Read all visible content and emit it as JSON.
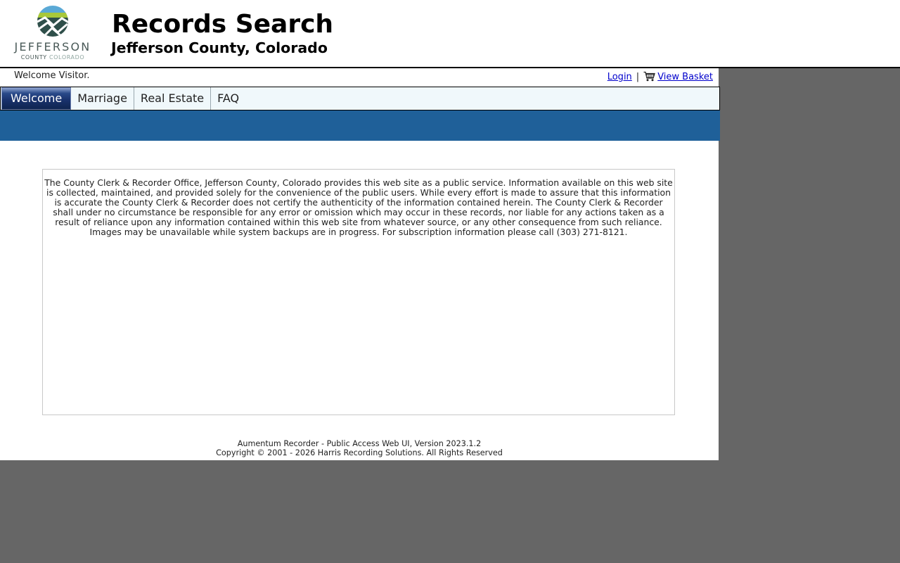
{
  "header": {
    "logo": {
      "word": "JEFFERSON",
      "sub_county": "COUNTY",
      "sub_state": "COLORADO"
    },
    "title": "Records Search",
    "subtitle": "Jefferson County, Colorado"
  },
  "userbar": {
    "welcome": "Welcome Visitor.",
    "login_label": "Login",
    "separator": "|",
    "basket_label": "View Basket"
  },
  "tabs": [
    {
      "label": "Welcome",
      "active": true
    },
    {
      "label": "Marriage",
      "active": false
    },
    {
      "label": "Real Estate",
      "active": false
    },
    {
      "label": "FAQ",
      "active": false
    }
  ],
  "notice": {
    "text": "The County Clerk & Recorder Office, Jefferson County, Colorado provides this web site as a public service. Information available on this web site is collected, maintained, and provided solely for the convenience of the public users. While every effort is made to assure that this information is accurate the County Clerk & Recorder does not certify the authenticity of the information contained herein. The County Clerk & Recorder shall under no circumstance be responsible for any error or omission which may occur in these records, nor liable for any actions taken as a result of reliance upon any information contained within this web site from whatever source, or any other consequence from such reliance. Images may be unavailable while system backups are in progress. For subscription information please call (303) 271-8121."
  },
  "footer": {
    "version": "Aumentum Recorder - Public Access Web UI, Version 2023.1.2",
    "copyright": "Copyright © 2001 - 2026  Harris Recording Solutions. All Rights Reserved"
  },
  "colors": {
    "page_background": "#666666",
    "blue_bar": "#1f6099",
    "tab_strip": "#f0f8fb",
    "active_tab": "#18306a",
    "link": "#0000cc"
  }
}
